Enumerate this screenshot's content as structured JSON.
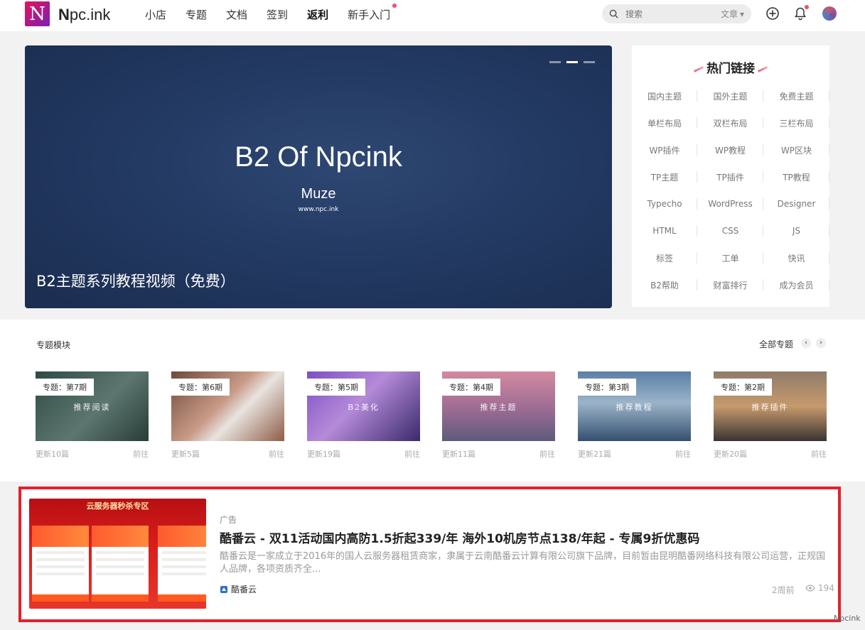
{
  "header": {
    "logo_letter": "N",
    "site_name_bold": "N",
    "site_name_rest": "pc.ink",
    "nav": [
      {
        "label": "小店",
        "bold": false,
        "dot": false
      },
      {
        "label": "专题",
        "bold": false,
        "dot": false
      },
      {
        "label": "文档",
        "bold": false,
        "dot": false
      },
      {
        "label": "签到",
        "bold": false,
        "dot": false
      },
      {
        "label": "返利",
        "bold": true,
        "dot": false
      },
      {
        "label": "新手入门",
        "bold": false,
        "dot": true
      }
    ],
    "search_placeholder": "搜索",
    "search_type": "文章",
    "icons": [
      "search-icon",
      "plus-circle-icon",
      "bell-icon",
      "avatar"
    ]
  },
  "slider": {
    "title": "B2 Of Npcink",
    "subtitle": "Muze",
    "url": "www.npc.ink",
    "caption": "B2主题系列教程视频（免费）",
    "dots": 3,
    "active_dot": 1
  },
  "hot_links": {
    "title": "热门链接",
    "items": [
      "国内主题",
      "国外主题",
      "免费主题",
      "单栏布局",
      "双栏布局",
      "三栏布局",
      "WP插件",
      "WP教程",
      "WP区块",
      "TP主题",
      "TP插件",
      "TP教程",
      "Typecho",
      "WordPress",
      "Designer",
      "HTML",
      "CSS",
      "JS",
      "标签",
      "工单",
      "快讯",
      "B2帮助",
      "财富排行",
      "成为会员"
    ]
  },
  "topics": {
    "heading": "专题模块",
    "all_label": "全部专题",
    "cards": [
      {
        "tag": "专题：第7期",
        "center": "推荐阅读",
        "updates": "更新10篇",
        "go": "前往",
        "bg": "linear-gradient(135deg,#2f4a45,#5d7670 55%,#283c38)"
      },
      {
        "tag": "专题：第6期",
        "center": "",
        "updates": "更新5篇",
        "go": "前往",
        "bg": "linear-gradient(135deg,#6e4a3c,#c89a86 45%,#e8e4e0 60%,#8e5c46)"
      },
      {
        "tag": "专题：第5期",
        "center": "B2美化",
        "updates": "更新19篇",
        "go": "前往",
        "bg": "linear-gradient(135deg,#7c4fc4,#b58ad9 45%,#3a2a6a)"
      },
      {
        "tag": "专题：第4期",
        "center": "推荐主题",
        "updates": "更新11篇",
        "go": "前往",
        "bg": "linear-gradient(180deg,#d38aa0,#9b6b93 55%,#5d5b7c)"
      },
      {
        "tag": "专题：第3期",
        "center": "推荐教程",
        "updates": "更新21篇",
        "go": "前往",
        "bg": "linear-gradient(180deg,#5a7fa6,#9bb4c9 45%,#34506f)"
      },
      {
        "tag": "专题：第2期",
        "center": "推荐插件",
        "updates": "更新20篇",
        "go": "前往",
        "bg": "linear-gradient(180deg,#8f7b6a,#c69a6c 50%,#3a3432)"
      }
    ]
  },
  "ad": {
    "banner": "云服务器秒杀专区",
    "label": "广告",
    "title": "酷番云 - 双11活动国内高防1.5折起339/年 海外10机房节点138/年起 - 专属9折优惠码",
    "description": "酷番云是一家成立于2016年的国人云服务器租赁商家，隶属于云南酷番云计算有限公司旗下品牌，目前暂由昆明酷番网络科技有限公司运营，正规国人品牌，各项资质齐全...",
    "brand": "酷番云",
    "time": "2周前",
    "views": "194"
  },
  "watermark": "Npcink"
}
